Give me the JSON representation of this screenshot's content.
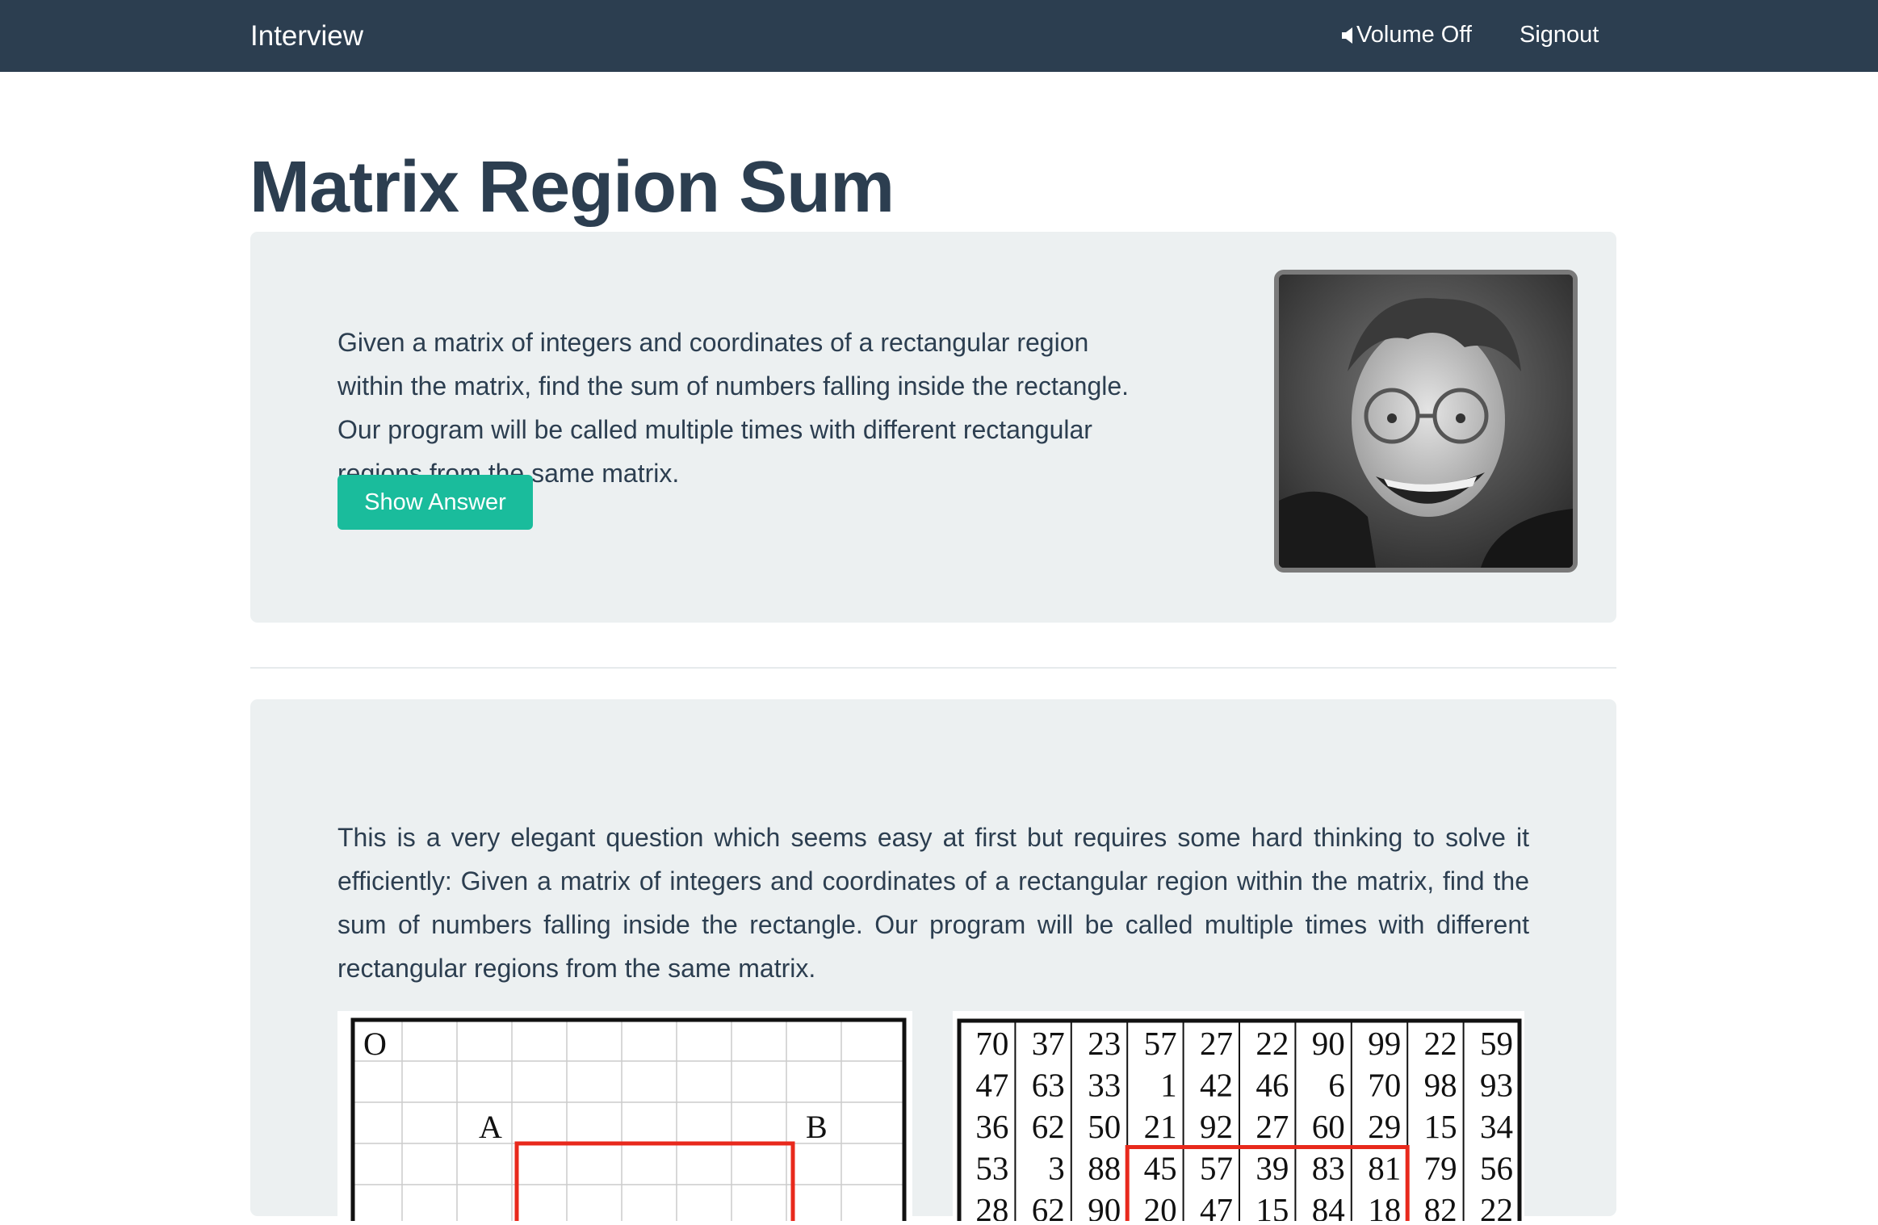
{
  "navbar": {
    "brand": "Interview",
    "volume_label": "Volume Off",
    "signout_label": "Signout"
  },
  "page": {
    "title": "Matrix Region Sum"
  },
  "question": {
    "text": "Given a matrix of integers and coordinates of a rectangular region within the matrix, find the sum of numbers falling inside the rectangle. Our program will be called multiple times with different rectangular regions from the same matrix.",
    "show_answer_label": "Show Answer"
  },
  "answer": {
    "text": "This is a very elegant question which seems easy at first but requires some hard thinking to solve it efficiently: Given a matrix of integers and coordinates of a rectangular region within the matrix, find the sum of numbers falling inside the rectangle. Our program will be called multiple times with different rectangular regions from the same matrix."
  },
  "figure": {
    "labels": {
      "origin": "O",
      "a": "A",
      "b": "B"
    },
    "matrix": [
      [
        "70",
        "37",
        "23",
        "57",
        "27",
        "22",
        "90",
        "99",
        "22",
        "59"
      ],
      [
        "47",
        "63",
        "33",
        "1",
        "42",
        "46",
        "6",
        "70",
        "98",
        "93"
      ],
      [
        "36",
        "62",
        "50",
        "21",
        "92",
        "27",
        "60",
        "29",
        "15",
        "34"
      ],
      [
        "53",
        "3",
        "88",
        "45",
        "57",
        "39",
        "83",
        "81",
        "79",
        "56"
      ],
      [
        "28",
        "62",
        "90",
        "20",
        "47",
        "15",
        "84",
        "18",
        "82",
        "22"
      ]
    ],
    "highlight_color": "#e8291c"
  },
  "colors": {
    "navbar": "#2c3e50",
    "primary_text": "#2c3e50",
    "panel": "#ecf0f1",
    "accent": "#1abc9c"
  },
  "icons": {
    "volume": "volume-off-icon"
  }
}
